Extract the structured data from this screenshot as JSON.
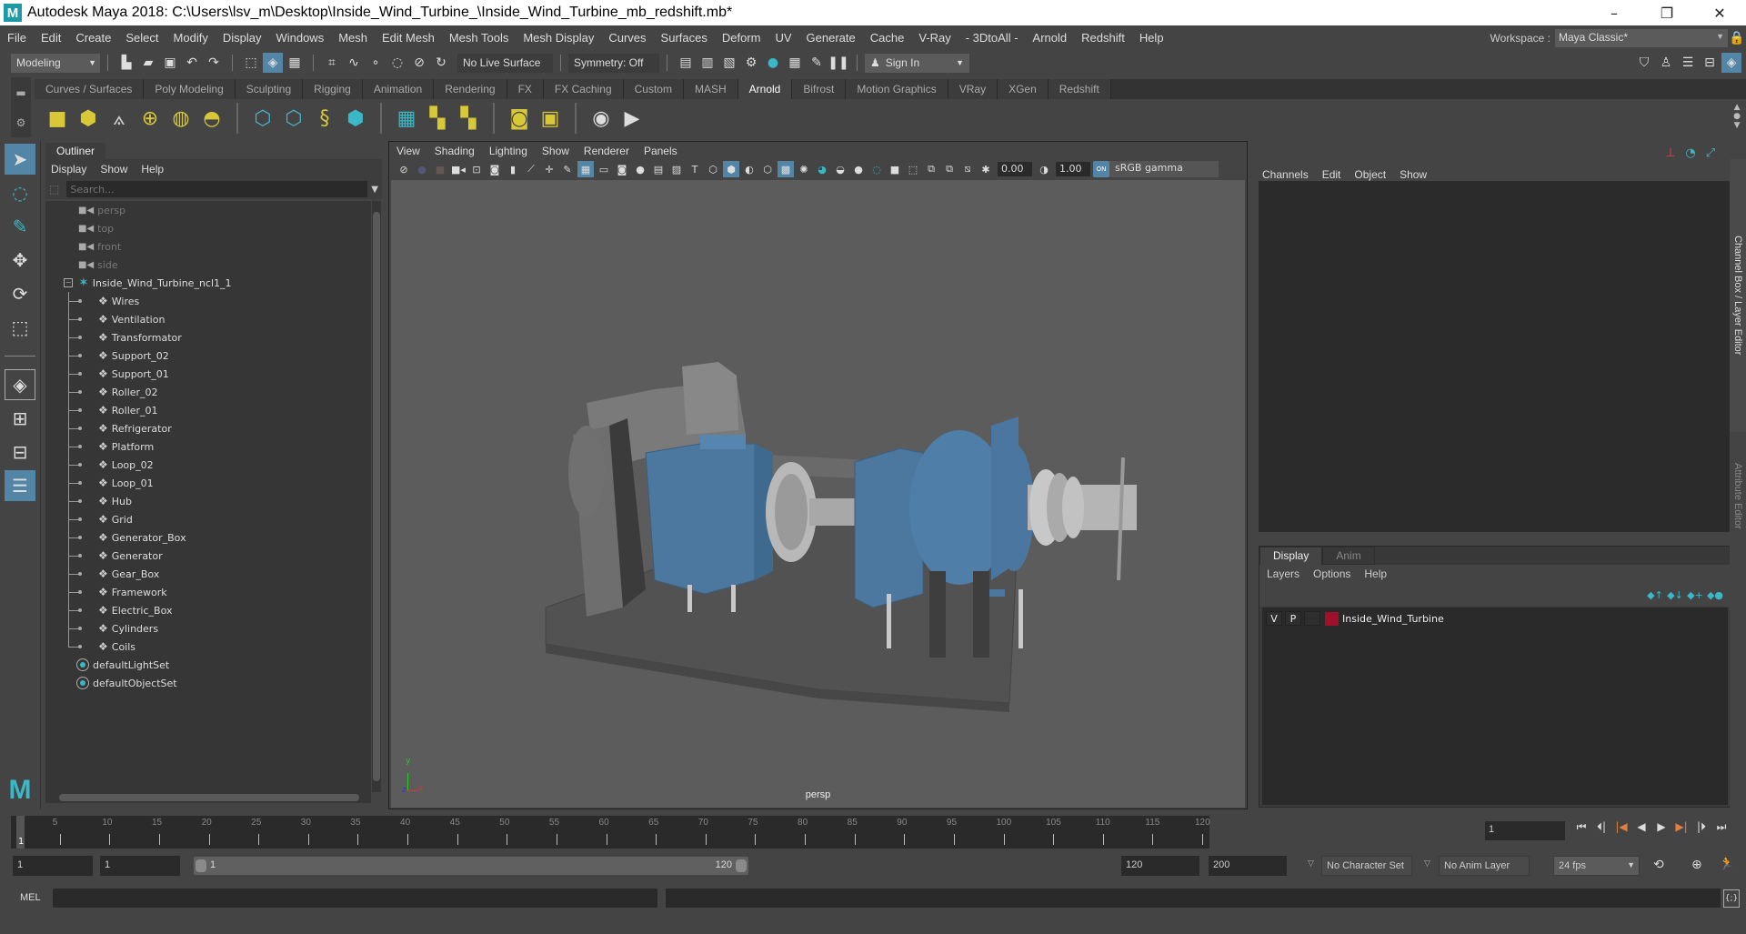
{
  "window": {
    "app_icon": "maya-logo-icon",
    "title": "Autodesk Maya 2018: C:\\Users\\lsv_m\\Desktop\\Inside_Wind_Turbine_\\Inside_Wind_Turbine_mb_redshift.mb*",
    "controls": {
      "minimize": "–",
      "maximize": "❐",
      "close": "✕"
    }
  },
  "menubar": {
    "items": [
      "File",
      "Edit",
      "Create",
      "Select",
      "Modify",
      "Display",
      "Windows",
      "Mesh",
      "Edit Mesh",
      "Mesh Tools",
      "Mesh Display",
      "Curves",
      "Surfaces",
      "Deform",
      "UV",
      "Generate",
      "Cache",
      "V-Ray",
      "- 3DtoAll -",
      "Arnold",
      "Redshift",
      "Help"
    ],
    "workspace_label": "Workspace :",
    "workspace_value": "Maya Classic*"
  },
  "statusline": {
    "menuset": "Modeling",
    "live_surface": "No Live Surface",
    "symmetry": "Symmetry: Off",
    "sign_in": "Sign In"
  },
  "shelf": {
    "tabs": [
      "Curves / Surfaces",
      "Poly Modeling",
      "Sculpting",
      "Rigging",
      "Animation",
      "Rendering",
      "FX",
      "FX Caching",
      "Custom",
      "MASH",
      "Arnold",
      "Bifrost",
      "Motion Graphics",
      "VRay",
      "XGen",
      "Redshift"
    ],
    "active_tab": "Arnold",
    "icons": [
      "area-light-icon",
      "mesh-light-icon",
      "photometric-light-icon",
      "skydome-light-icon",
      "physical-sky-icon",
      "sun-light-icon",
      "standin-create-icon",
      "standin-export-icon",
      "curve-collector-icon",
      "volume-icon",
      "render-view-icon",
      "texture-tx-icon",
      "flush-texture-icon",
      "light-manager-icon",
      "shader-ball-icon",
      "ipr-view-icon",
      "render-icon"
    ]
  },
  "outliner": {
    "title": "Outliner",
    "menu": [
      "Display",
      "Show",
      "Help"
    ],
    "search_placeholder": "Search...",
    "cameras": [
      "persp",
      "top",
      "front",
      "side"
    ],
    "root": "Inside_Wind_Turbine_ncl1_1",
    "children": [
      "Wires",
      "Ventilation",
      "Transformator",
      "Support_02",
      "Support_01",
      "Roller_02",
      "Roller_01",
      "Refrigerator",
      "Platform",
      "Loop_02",
      "Loop_01",
      "Hub",
      "Grid",
      "Generator_Box",
      "Generator",
      "Gear_Box",
      "Framework",
      "Electric_Box",
      "Cylinders",
      "Coils"
    ],
    "sets": [
      "defaultLightSet",
      "defaultObjectSet"
    ]
  },
  "viewport": {
    "menu": [
      "View",
      "Shading",
      "Lighting",
      "Show",
      "Renderer",
      "Panels"
    ],
    "exposure": "0.00",
    "gamma": "1.00",
    "color_mgmt_badge": "ON",
    "color_space": "sRGB gamma",
    "camera_label": "persp",
    "axis": {
      "x": "x",
      "y": "y",
      "z": "z"
    }
  },
  "channelbox": {
    "menu": [
      "Channels",
      "Edit",
      "Object",
      "Show"
    ],
    "side_tabs": [
      "Channel Box / Layer Editor",
      "Attribute Editor"
    ]
  },
  "layers": {
    "tabs": [
      "Display",
      "Anim"
    ],
    "active_tab": "Display",
    "menu": [
      "Layers",
      "Options",
      "Help"
    ],
    "rows": [
      {
        "v": "V",
        "p": "P",
        "color": "#a0102a",
        "name": "Inside_Wind_Turbine"
      }
    ]
  },
  "timeline": {
    "start": 1,
    "end": 120,
    "ticks": [
      5,
      10,
      15,
      20,
      25,
      30,
      35,
      40,
      45,
      50,
      55,
      60,
      65,
      70,
      75,
      80,
      85,
      90,
      95,
      100,
      105,
      110,
      115,
      120
    ],
    "current_frame": "1",
    "current_frame_field": "1"
  },
  "range": {
    "anim_start": "1",
    "playback_start": "1",
    "slider_min_label": "1",
    "slider_max_label": "120",
    "playback_end": "120",
    "anim_end": "200",
    "character_set": "No Character Set",
    "anim_layer": "No Anim Layer",
    "fps": "24 fps"
  },
  "command_line": {
    "language": "MEL"
  },
  "colors": {
    "accent": "#5285a6",
    "teal": "#3bb8c8",
    "panel_bg": "#444444",
    "field_bg": "#2a2a2a",
    "viewport_bg": "#5c5c5c",
    "model_blue": "#4f7ea8",
    "layer_color": "#a0102a"
  }
}
